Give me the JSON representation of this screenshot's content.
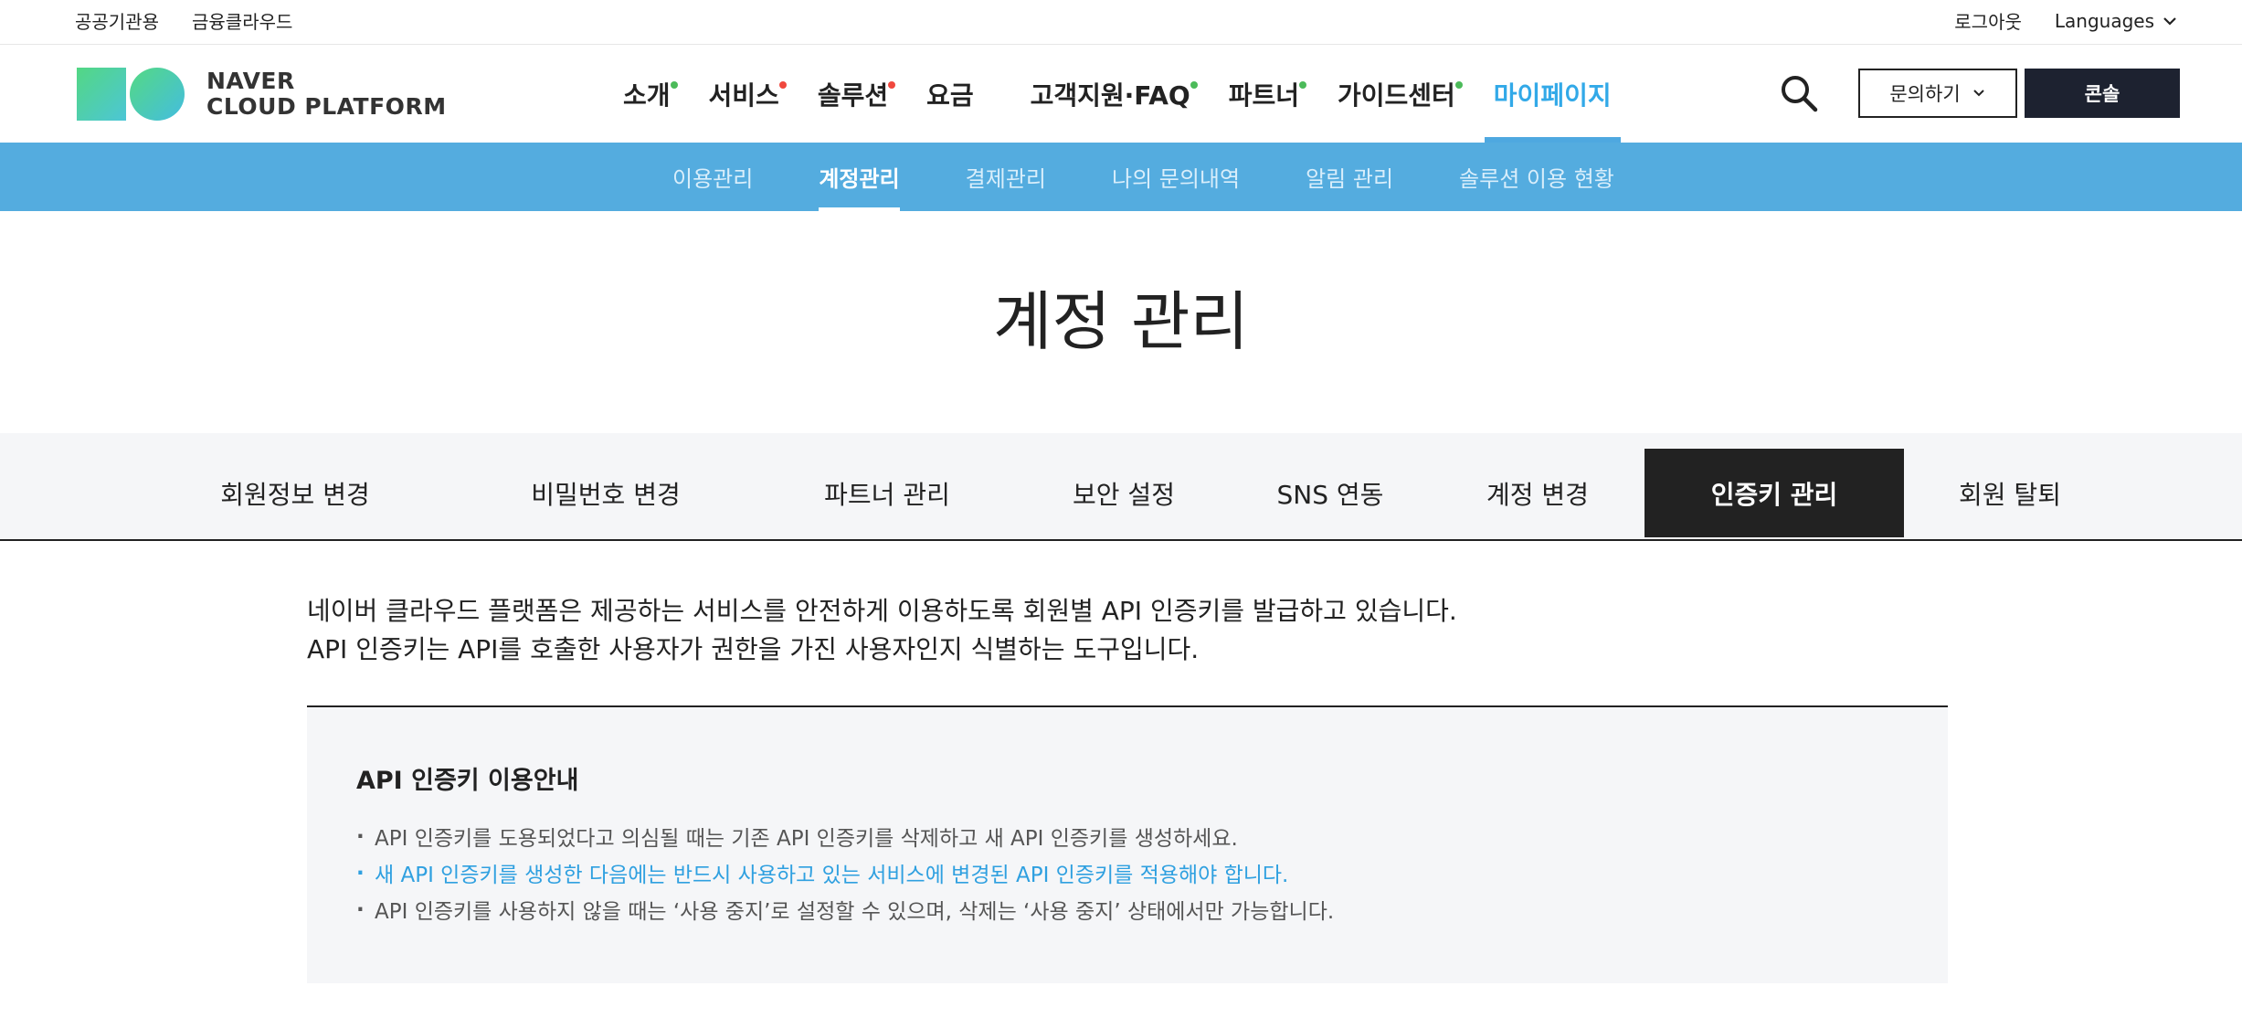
{
  "util": {
    "left_links": [
      "공공기관용",
      "금융클라우드"
    ],
    "logout": "로그아웃",
    "languages": "Languages"
  },
  "logo": {
    "line1": "NAVER",
    "line2": "CLOUD PLATFORM"
  },
  "gnb": {
    "items": [
      {
        "label": "소개",
        "dot_color": "#4cbb5a"
      },
      {
        "label": "서비스",
        "dot_color": "#f0483e"
      },
      {
        "label": "솔루션",
        "dot_color": "#f0483e"
      },
      {
        "label": "요금",
        "dot_color": ""
      },
      {
        "label": "고객지원·FAQ",
        "dot_color": "#4cbb5a"
      },
      {
        "label": "파트너",
        "dot_color": "#4cbb5a"
      },
      {
        "label": "가이드센터",
        "dot_color": "#4cbb5a"
      },
      {
        "label": "마이페이지",
        "dot_color": ""
      }
    ]
  },
  "header_buttons": {
    "contact": "문의하기",
    "console": "콘솔"
  },
  "sub_nav": {
    "items": [
      "이용관리",
      "계정관리",
      "결제관리",
      "나의 문의내역",
      "알림 관리",
      "솔루션 이용 현황"
    ]
  },
  "page": {
    "title": "계정 관리"
  },
  "tabs": {
    "items": [
      "회원정보 변경",
      "비밀번호 변경",
      "파트너 관리",
      "보안 설정",
      "SNS 연동",
      "계정 변경",
      "인증키 관리",
      "회원 탈퇴"
    ]
  },
  "intro": {
    "line1": "네이버 클라우드 플랫폼은 제공하는 서비스를 안전하게 이용하도록 회원별 API 인증키를 발급하고 있습니다.",
    "line2": "API 인증키는 API를 호출한 사용자가 권한을 가진 사용자인지 식별하는 도구입니다."
  },
  "guide": {
    "title": "API 인증키 이용안내",
    "items": [
      "API 인증키를 도용되었다고 의심될 때는 기존 API 인증키를 삭제하고 새 API 인증키를 생성하세요.",
      "새 API 인증키를 생성한 다음에는 반드시 사용하고 있는 서비스에 변경된 API 인증키를 적용해야 합니다.",
      "API 인증키를 사용하지 않을 때는 ‘사용 중지’로 설정할 수 있으며, 삭제는 ‘사용 중지’ 상태에서만 가능합니다."
    ]
  },
  "colors": {
    "accent": "#32a9e8",
    "subnav_bg": "#54acdf",
    "console_bg": "#1d2230",
    "active_tab_bg": "#222222"
  }
}
